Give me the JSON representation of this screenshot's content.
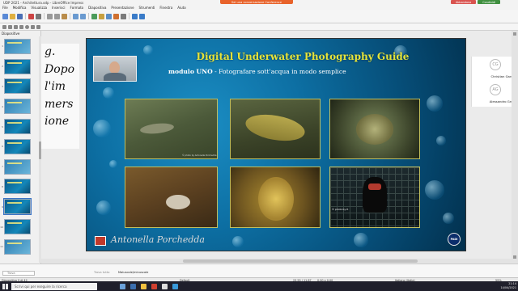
{
  "window": {
    "title": "UDP 2021 - Architettura.odp - LibreOffice Impress",
    "meet_banner": "Sei una conversazione Conference",
    "buttons": {
      "leave": "Abbandona",
      "share": "Condividi"
    }
  },
  "menu": [
    "File",
    "Modifica",
    "Visualizza",
    "Inserisci",
    "Formato",
    "Diapositiva",
    "Presentazione",
    "Strumenti",
    "Finestra",
    "Aiuto"
  ],
  "slides_panel": {
    "header": "Diapositive",
    "count": 12,
    "selected_index": 8
  },
  "notes_overlay": [
    "g.",
    "Dopo",
    "l'im",
    "mers",
    "ione"
  ],
  "slide": {
    "title": "Digital Underwater Photography Guide",
    "subtitle_bold": "modulo UNO",
    "subtitle_rest": " - Fotografare sott'acqua in modo semplice",
    "photo1_caption": "© photo by Antonella Porchedda",
    "photo6_caption": "© photo by P.",
    "signature": "Antonella Porchedda",
    "padi_logo_text": "PADI"
  },
  "participants": [
    {
      "initials": "CG",
      "name": "Christian Garetta"
    },
    {
      "initials": "AG",
      "name": "Alessandro Gregis"
    }
  ],
  "bottom": {
    "find_placeholder": "Trova",
    "notes_label": "Trova tutto",
    "match_case": "Maiuscole/minuscole"
  },
  "status": {
    "slide_info": "Diapositiva 9 di 42",
    "layout": "Default",
    "coords": "23,55 / 11,87",
    "size": "0,00 x 0,00",
    "language": "Italiano (Italia)",
    "zoom": "59%"
  },
  "taskbar": {
    "search_placeholder": "Scrivi qui per eseguire la ricerca",
    "time": "21:14",
    "date": "14/04/2021"
  },
  "colors": {
    "title": "#e6e43a",
    "accent": "#3973c6",
    "banner": "#e8622a"
  }
}
